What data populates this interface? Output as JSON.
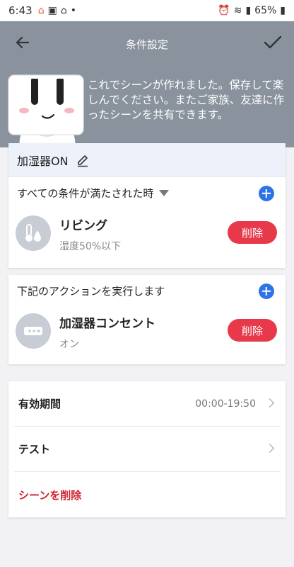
{
  "status_bar": {
    "time": "6:43",
    "battery": "65%"
  },
  "header": {
    "title": "条件設定"
  },
  "hero": {
    "message": "これでシーンが作れました。保存して楽しんでください。またご家族、友達に作ったシーンを共有できます。"
  },
  "scene": {
    "name": "加湿器ON"
  },
  "conditions": {
    "header": "すべての条件が満たされた時",
    "items": [
      {
        "title": "リビング",
        "subtitle": "湿度50%以下",
        "delete_label": "削除"
      }
    ]
  },
  "actions": {
    "header": "下記のアクションを実行します",
    "items": [
      {
        "title": "加湿器コンセント",
        "subtitle": "オン",
        "delete_label": "削除"
      }
    ]
  },
  "options": {
    "validity_label": "有効期間",
    "validity_value": "00:00-19:50",
    "test_label": "テスト",
    "delete_scene_label": "シーンを削除"
  },
  "colors": {
    "header_bg": "#8a929e",
    "accent_blue": "#2f74e6",
    "delete_red": "#e8394a",
    "danger_text": "#d0202e"
  }
}
